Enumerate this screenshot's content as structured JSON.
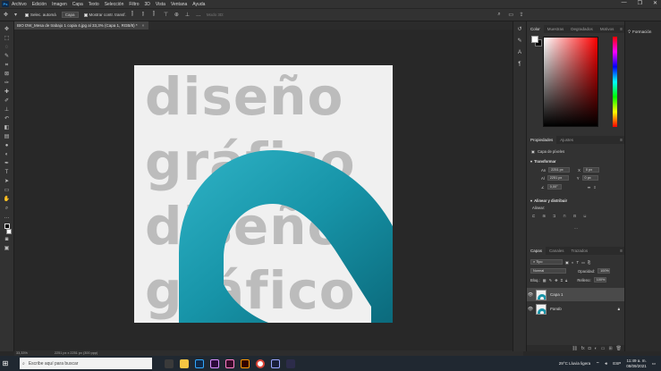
{
  "menubar": {
    "logo": "Ps",
    "items": [
      "Archivo",
      "Edición",
      "Imagen",
      "Capa",
      "Texto",
      "Selección",
      "Filtro",
      "3D",
      "Vista",
      "Ventana",
      "Ayuda"
    ],
    "win_controls": [
      "—",
      "❐",
      "✕"
    ]
  },
  "options": {
    "auto_select_label": "Selec. automá",
    "layer_select": "Capa",
    "show_transform_label": "Mostrar contr. transf.",
    "mode_3d": "Modo 3D:"
  },
  "document": {
    "tab_title": "BIO DW_Mesa de trabajo 1 copia 4.jpg al 33,3% (Capa 1, RGB/8) *",
    "close": "×",
    "words": [
      "diseño",
      "gráfico",
      "diseño",
      "gráfico"
    ]
  },
  "statusbar": {
    "zoom": "33,33%",
    "docinfo": "2251 px x 2251 px (300 ppp)"
  },
  "color_panel": {
    "tabs": [
      "Color",
      "Muestras",
      "Degradados",
      "Motivos"
    ],
    "active_tab": "Color"
  },
  "properties_panel": {
    "tabs": [
      "Propiedades",
      "Ajustes"
    ],
    "active_tab": "Propiedades",
    "layer_type": "Capa de píxeles",
    "transform_title": "Transformar",
    "w_label": "An",
    "w_value": "2251 px",
    "x_label": "X",
    "x_value": "0 px",
    "h_label": "Al",
    "h_value": "2251 px",
    "y_label": "Y",
    "y_value": "0 px",
    "angle_value": "0,00°",
    "align_title": "Alinear y distribuir",
    "align_label": "Alinear:",
    "more": "..."
  },
  "layers_panel": {
    "tabs": [
      "Capas",
      "Canales",
      "Trazados"
    ],
    "active_tab": "Capas",
    "filter_kind": "Tipo",
    "blend_mode": "Normal",
    "opacity_label": "Opacidad:",
    "opacity_value": "100%",
    "lock_label": "Bloq.:",
    "fill_label": "Relleno:",
    "fill_value": "100%",
    "layers": [
      {
        "name": "Capa 1",
        "selected": true
      },
      {
        "name": "Fondo",
        "selected": false
      }
    ]
  },
  "far_right": {
    "label": "Formación"
  },
  "taskbar": {
    "search_placeholder": "Escribe aquí para buscar",
    "weather": "29°C  Lluvia ligera",
    "lang": "ESP",
    "time": "11:49 a. m.",
    "date": "08/09/2021"
  },
  "colors": {
    "teal": "#1794a8",
    "teal_light": "#2aa9bd",
    "teal_dark": "#0e6f82"
  }
}
